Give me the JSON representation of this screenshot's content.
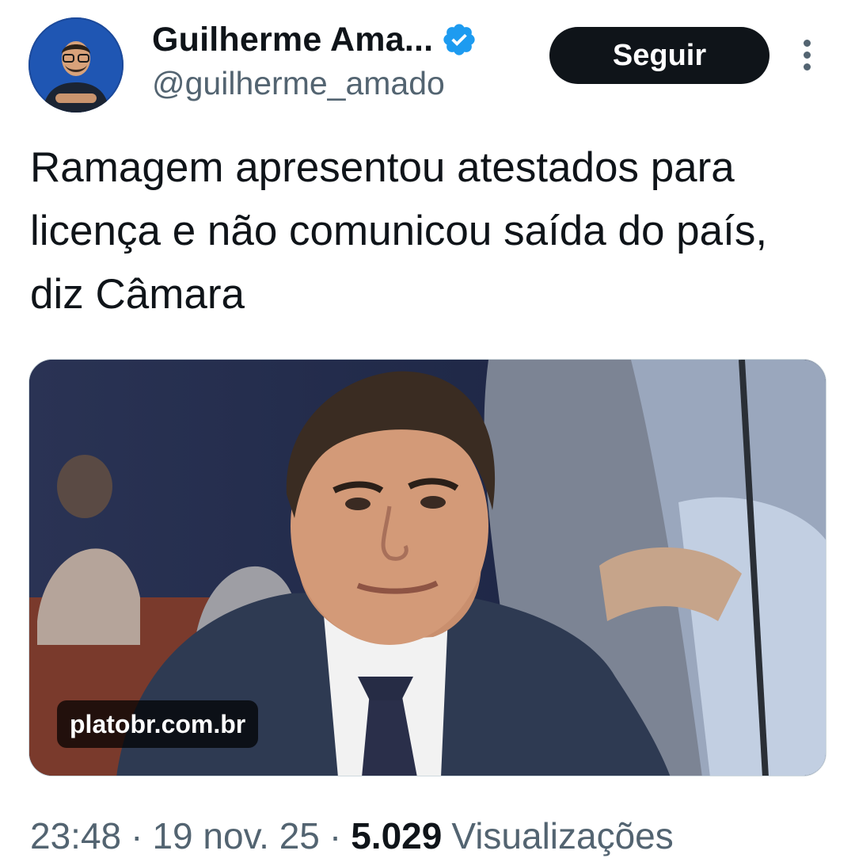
{
  "author": {
    "display_name": "Guilherme Ama...",
    "handle": "@guilherme_amado",
    "verified_icon": "verified-badge-icon"
  },
  "actions": {
    "follow_label": "Seguir",
    "more_icon": "more-vertical-icon"
  },
  "tweet": {
    "text": "Ramagem apresentou atestados para licença e não comunicou saída do país, diz Câmara"
  },
  "card": {
    "domain": "platobr.com.br"
  },
  "meta": {
    "time": "23:48",
    "separator": "·",
    "date": "19 nov. 25",
    "views_count": "5.029",
    "views_label": "Visualizações"
  },
  "colors": {
    "accent": "#1d9bf0",
    "text_primary": "#0f1419",
    "text_secondary": "#536471",
    "button_bg": "#0f1419"
  }
}
